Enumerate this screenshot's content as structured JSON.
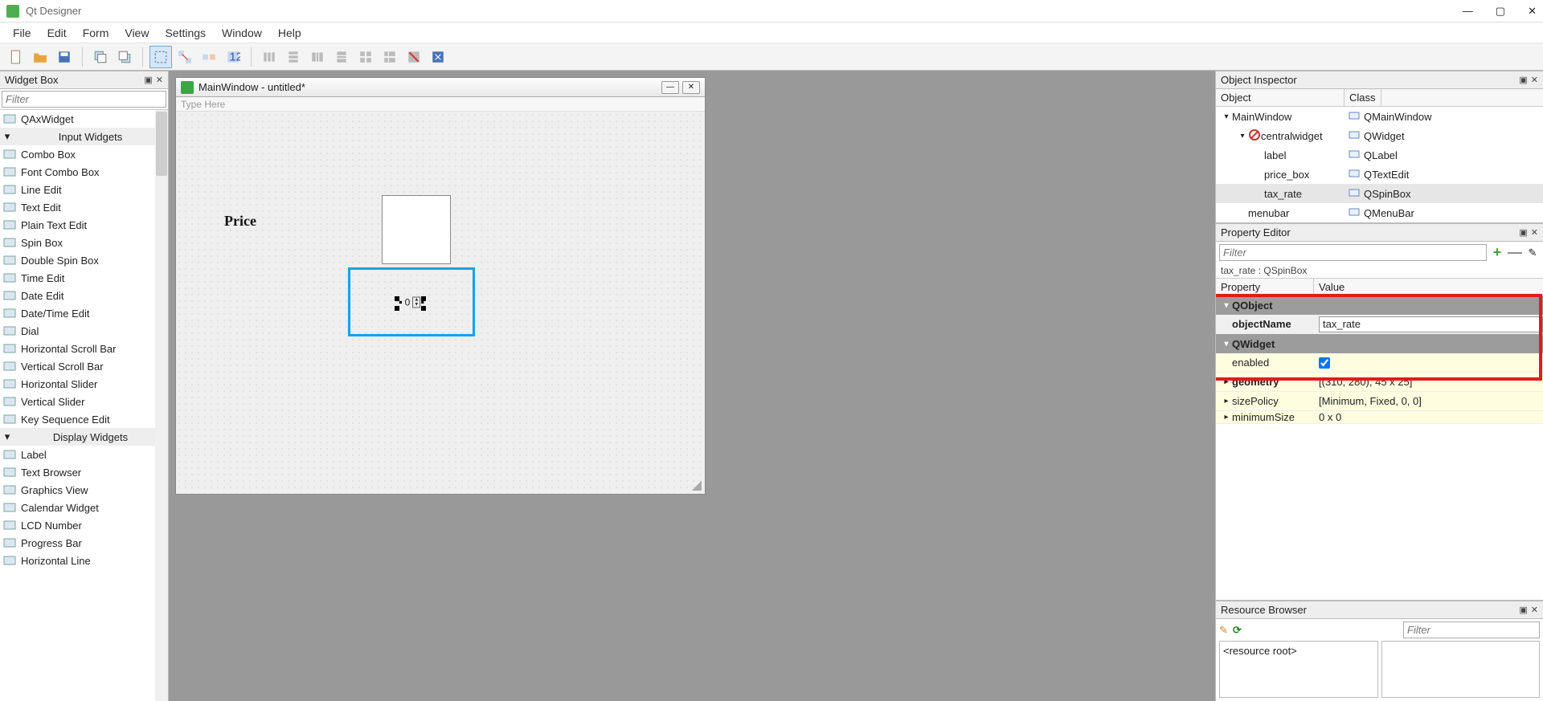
{
  "app": {
    "title": "Qt Designer"
  },
  "menus": [
    "File",
    "Edit",
    "Form",
    "View",
    "Settings",
    "Window",
    "Help"
  ],
  "widgetbox": {
    "title": "Widget Box",
    "filter_placeholder": "Filter",
    "items": [
      {
        "type": "item",
        "label": "QAxWidget"
      },
      {
        "type": "cat",
        "label": "Input Widgets"
      },
      {
        "type": "item",
        "label": "Combo Box"
      },
      {
        "type": "item",
        "label": "Font Combo Box"
      },
      {
        "type": "item",
        "label": "Line Edit"
      },
      {
        "type": "item",
        "label": "Text Edit"
      },
      {
        "type": "item",
        "label": "Plain Text Edit"
      },
      {
        "type": "item",
        "label": "Spin Box"
      },
      {
        "type": "item",
        "label": "Double Spin Box"
      },
      {
        "type": "item",
        "label": "Time Edit"
      },
      {
        "type": "item",
        "label": "Date Edit"
      },
      {
        "type": "item",
        "label": "Date/Time Edit"
      },
      {
        "type": "item",
        "label": "Dial"
      },
      {
        "type": "item",
        "label": "Horizontal Scroll Bar"
      },
      {
        "type": "item",
        "label": "Vertical Scroll Bar"
      },
      {
        "type": "item",
        "label": "Horizontal Slider"
      },
      {
        "type": "item",
        "label": "Vertical Slider"
      },
      {
        "type": "item",
        "label": "Key Sequence Edit"
      },
      {
        "type": "cat",
        "label": "Display Widgets"
      },
      {
        "type": "item",
        "label": "Label"
      },
      {
        "type": "item",
        "label": "Text Browser"
      },
      {
        "type": "item",
        "label": "Graphics View"
      },
      {
        "type": "item",
        "label": "Calendar Widget"
      },
      {
        "type": "item",
        "label": "LCD Number"
      },
      {
        "type": "item",
        "label": "Progress Bar"
      },
      {
        "type": "item",
        "label": "Horizontal Line"
      }
    ]
  },
  "design_window": {
    "title": "MainWindow - untitled*",
    "type_here": "Type Here",
    "price_label": "Price",
    "spin_value": "0"
  },
  "object_inspector": {
    "title": "Object Inspector",
    "col_object": "Object",
    "col_class": "Class",
    "rows": [
      {
        "indent": 0,
        "obj": "MainWindow",
        "cls": "QMainWindow",
        "exp": true
      },
      {
        "indent": 1,
        "obj": "centralwidget",
        "cls": "QWidget",
        "exp": true,
        "icon": "forbid"
      },
      {
        "indent": 2,
        "obj": "label",
        "cls": "QLabel"
      },
      {
        "indent": 2,
        "obj": "price_box",
        "cls": "QTextEdit"
      },
      {
        "indent": 2,
        "obj": "tax_rate",
        "cls": "QSpinBox",
        "sel": true
      },
      {
        "indent": 1,
        "obj": "menubar",
        "cls": "QMenuBar"
      }
    ]
  },
  "property_editor": {
    "title": "Property Editor",
    "filter_placeholder": "Filter",
    "status": "tax_rate : QSpinBox",
    "col_prop": "Property",
    "col_val": "Value",
    "sect_qobject": "QObject",
    "sect_qwidget": "QWidget",
    "rows": {
      "objectName_label": "objectName",
      "objectName_value": "tax_rate",
      "enabled_label": "enabled",
      "geometry_label": "geometry",
      "geometry_value": "[(310, 280), 45 x 25]",
      "sizePolicy_label": "sizePolicy",
      "sizePolicy_value": "[Minimum, Fixed, 0, 0]",
      "minimumSize_label": "minimumSize",
      "minimumSize_value": "0 x 0"
    }
  },
  "resource_browser": {
    "title": "Resource Browser",
    "filter_placeholder": "Filter",
    "root": "<resource root>"
  }
}
